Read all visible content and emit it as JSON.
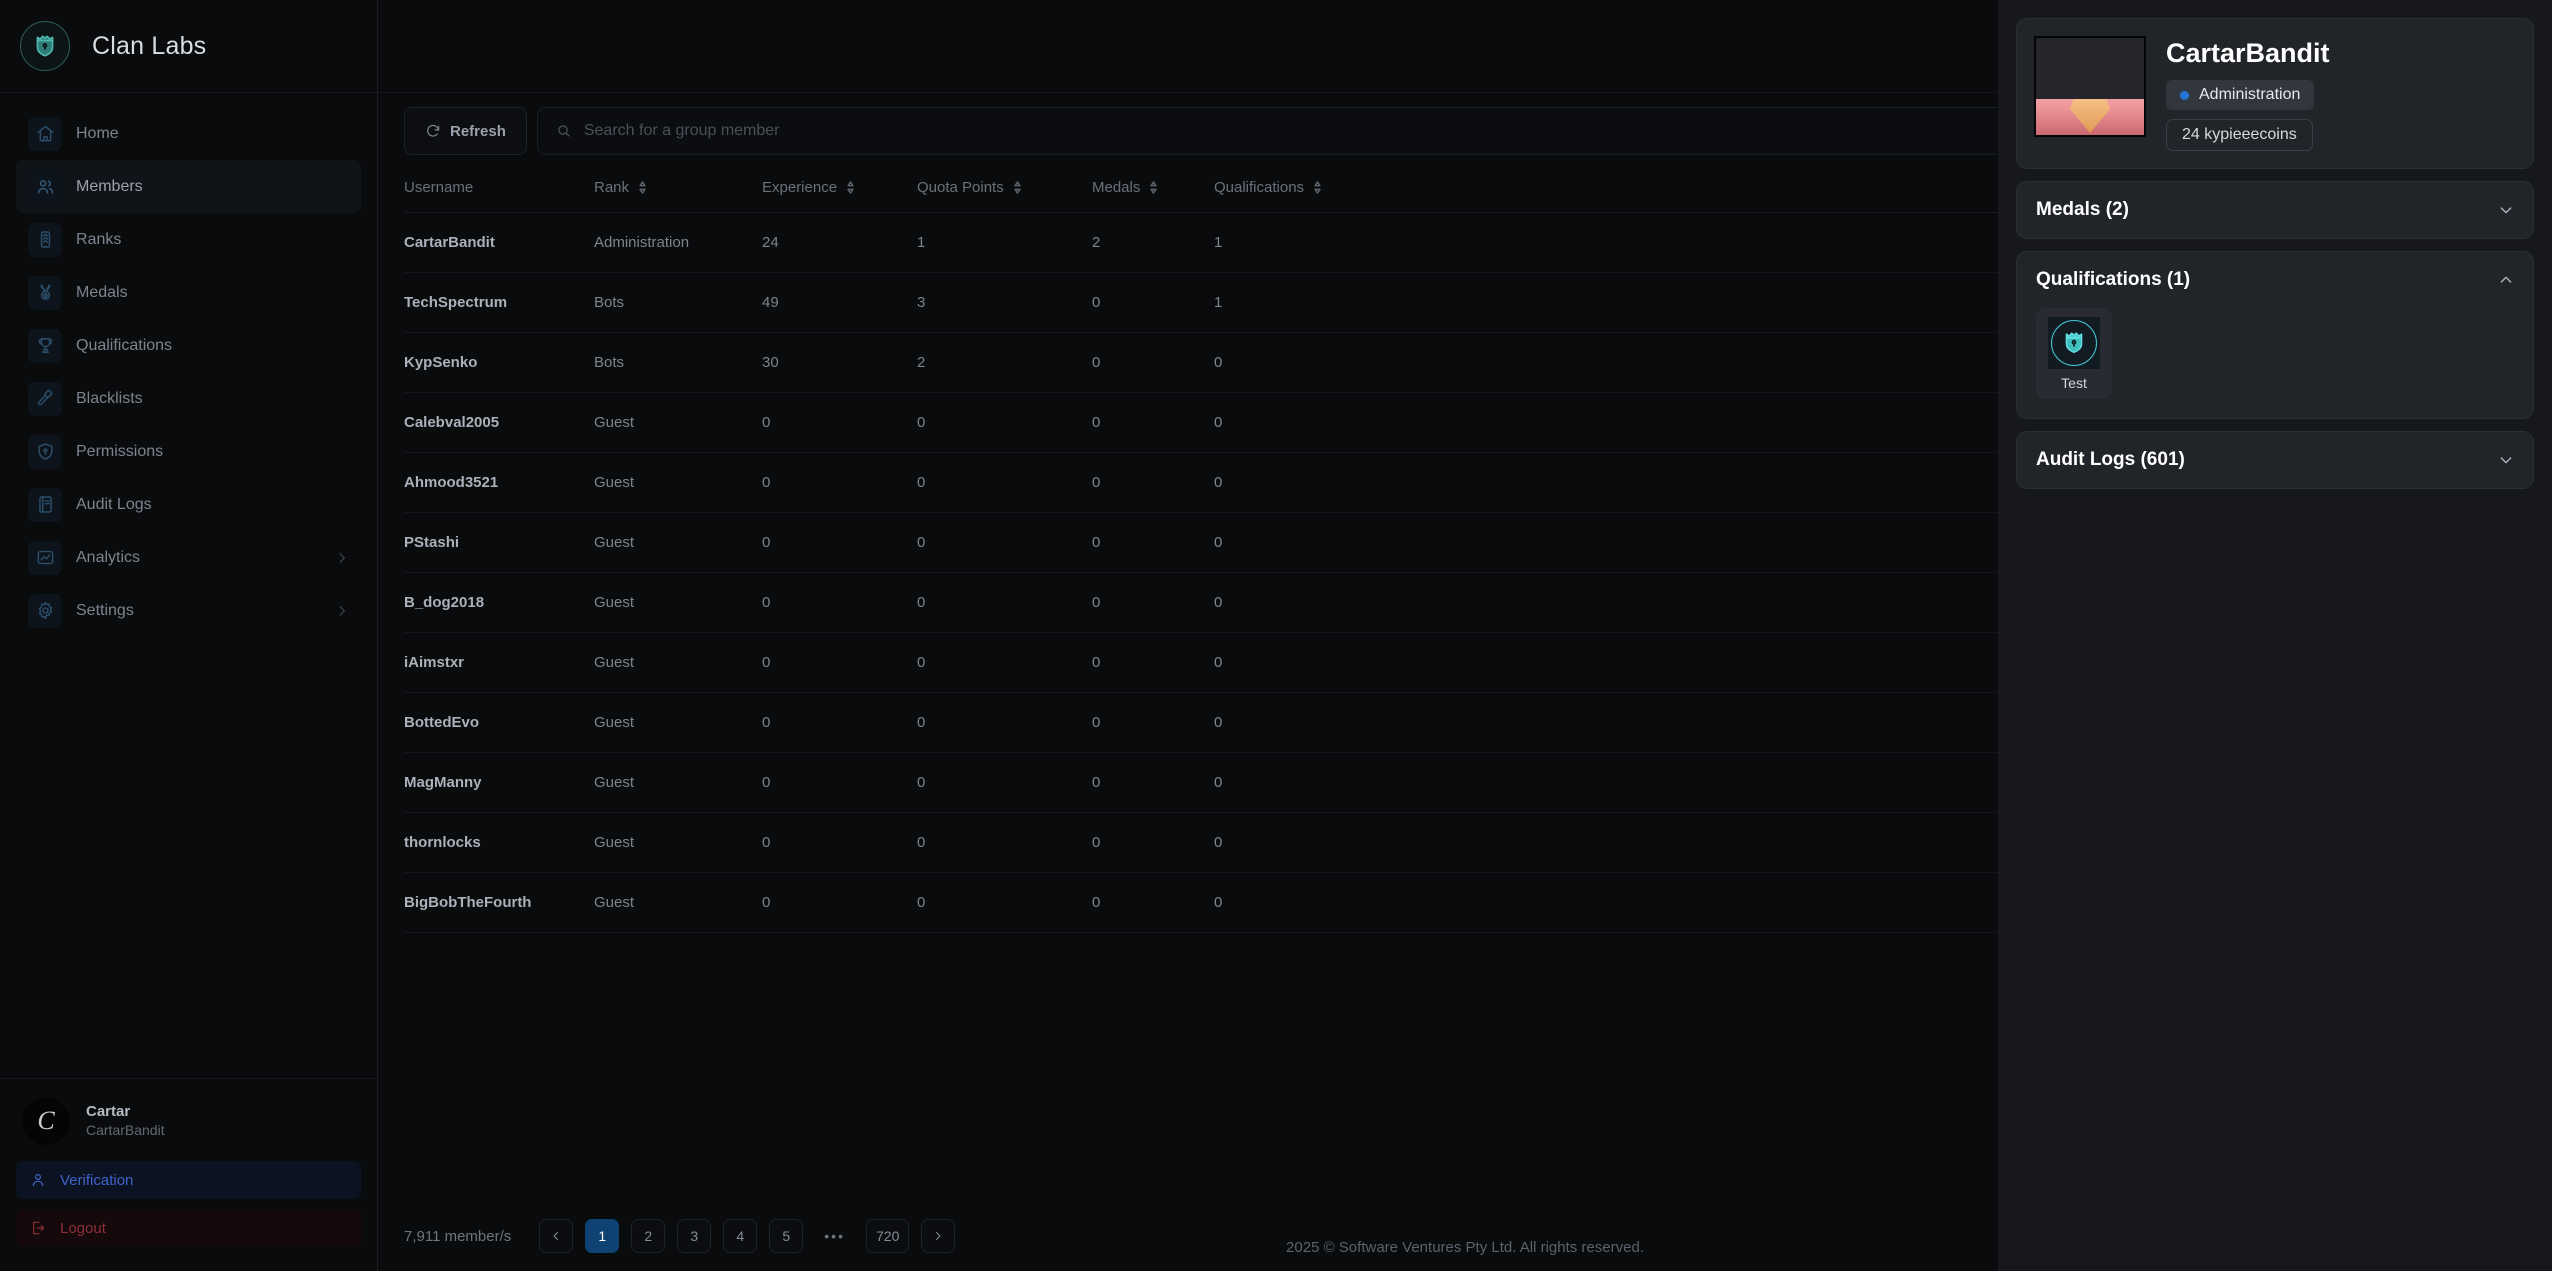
{
  "brand": {
    "name": "Clan Labs",
    "logo_icon": "shield-crown-icon"
  },
  "sidebar": {
    "items": [
      {
        "label": "Home",
        "icon": "home-icon",
        "active": false,
        "expandable": false
      },
      {
        "label": "Members",
        "icon": "users-icon",
        "active": true,
        "expandable": false
      },
      {
        "label": "Ranks",
        "icon": "rank-insignia-icon",
        "active": false,
        "expandable": false
      },
      {
        "label": "Medals",
        "icon": "medal-icon",
        "active": false,
        "expandable": false
      },
      {
        "label": "Qualifications",
        "icon": "trophy-icon",
        "active": false,
        "expandable": false
      },
      {
        "label": "Blacklists",
        "icon": "gavel-icon",
        "active": false,
        "expandable": false
      },
      {
        "label": "Permissions",
        "icon": "shield-lock-icon",
        "active": false,
        "expandable": false
      },
      {
        "label": "Audit Logs",
        "icon": "book-icon",
        "active": false,
        "expandable": false
      },
      {
        "label": "Analytics",
        "icon": "chart-image-icon",
        "active": false,
        "expandable": true
      },
      {
        "label": "Settings",
        "icon": "gear-icon",
        "active": false,
        "expandable": true
      }
    ],
    "profile": {
      "avatar_letter": "C",
      "name": "Cartar",
      "username": "CartarBandit"
    },
    "verification_label": "Verification",
    "logout_label": "Logout"
  },
  "toolbar": {
    "refresh_label": "Refresh",
    "refresh_icon": "refresh-icon",
    "search_placeholder": "Search for a group member",
    "search_value": "",
    "search_icon": "search-icon"
  },
  "table": {
    "columns": [
      {
        "label": "Username",
        "sortable": false
      },
      {
        "label": "Rank",
        "sortable": true
      },
      {
        "label": "Experience",
        "sortable": true
      },
      {
        "label": "Quota Points",
        "sortable": true
      },
      {
        "label": "Medals",
        "sortable": true
      },
      {
        "label": "Qualifications",
        "sortable": true
      }
    ],
    "rows": [
      {
        "username": "CartarBandit",
        "rank": "Administration",
        "experience": "24",
        "quota_points": "1",
        "medals": "2",
        "qualifications": "1"
      },
      {
        "username": "TechSpectrum",
        "rank": "Bots",
        "experience": "49",
        "quota_points": "3",
        "medals": "0",
        "qualifications": "1"
      },
      {
        "username": "KypSenko",
        "rank": "Bots",
        "experience": "30",
        "quota_points": "2",
        "medals": "0",
        "qualifications": "0"
      },
      {
        "username": "Calebval2005",
        "rank": "Guest",
        "experience": "0",
        "quota_points": "0",
        "medals": "0",
        "qualifications": "0"
      },
      {
        "username": "Ahmood3521",
        "rank": "Guest",
        "experience": "0",
        "quota_points": "0",
        "medals": "0",
        "qualifications": "0"
      },
      {
        "username": "PStashi",
        "rank": "Guest",
        "experience": "0",
        "quota_points": "0",
        "medals": "0",
        "qualifications": "0"
      },
      {
        "username": "B_dog2018",
        "rank": "Guest",
        "experience": "0",
        "quota_points": "0",
        "medals": "0",
        "qualifications": "0"
      },
      {
        "username": "iAimstxr",
        "rank": "Guest",
        "experience": "0",
        "quota_points": "0",
        "medals": "0",
        "qualifications": "0"
      },
      {
        "username": "BottedEvo",
        "rank": "Guest",
        "experience": "0",
        "quota_points": "0",
        "medals": "0",
        "qualifications": "0"
      },
      {
        "username": "MagManny",
        "rank": "Guest",
        "experience": "0",
        "quota_points": "0",
        "medals": "0",
        "qualifications": "0"
      },
      {
        "username": "thornlocks",
        "rank": "Guest",
        "experience": "0",
        "quota_points": "0",
        "medals": "0",
        "qualifications": "0"
      },
      {
        "username": "BigBobTheFourth",
        "rank": "Guest",
        "experience": "0",
        "quota_points": "0",
        "medals": "0",
        "qualifications": "0"
      }
    ]
  },
  "pagination": {
    "count_label": "7,911 member/s",
    "prev_icon": "chevron-left-icon",
    "next_icon": "chevron-right-icon",
    "pages": [
      "1",
      "2",
      "3",
      "4",
      "5"
    ],
    "ellipsis": "•••",
    "last_page": "720",
    "current_page": "1"
  },
  "footer": {
    "text": "2025 © Software Ventures Pty Ltd. All rights reserved."
  },
  "right_panel": {
    "profile": {
      "title": "CartarBandit",
      "rank_chip": "Administration",
      "rank_dot_color": "#2176d8",
      "coins_chip": "24 kypieeecoins"
    },
    "sections": [
      {
        "title": "Medals (2)",
        "expanded": false,
        "chevron": "chevron-down-icon"
      },
      {
        "title": "Qualifications (1)",
        "expanded": true,
        "chevron": "chevron-up-icon"
      },
      {
        "title": "Audit Logs (601)",
        "expanded": false,
        "chevron": "chevron-down-icon"
      }
    ],
    "qualifications": [
      {
        "name": "Test",
        "icon": "shield-crown-badge-icon"
      }
    ]
  }
}
